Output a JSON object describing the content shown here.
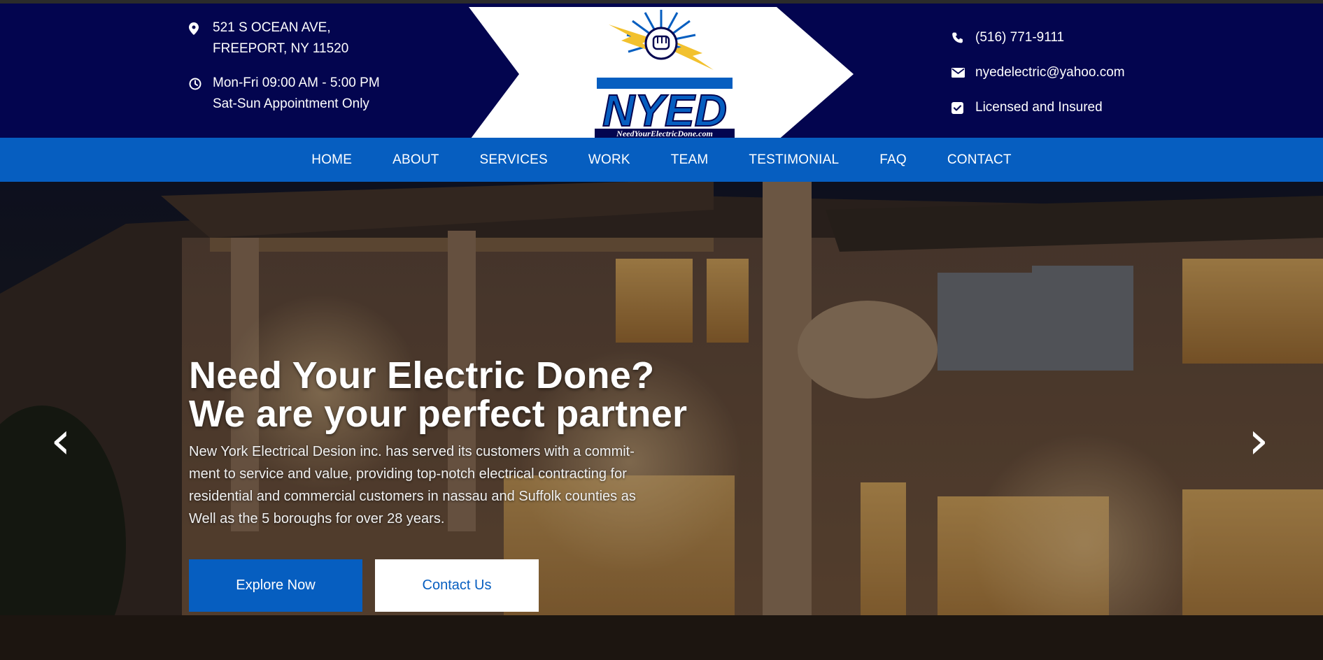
{
  "header": {
    "address_line1": "521 S OCEAN AVE,",
    "address_line2": "FREEPORT, NY 11520",
    "hours_line1": "Mon-Fri 09:00 AM - 5:00 PM",
    "hours_line2": "Sat-Sun Appointment Only",
    "phone": "(516) 771-9111",
    "email": "nyedelectric@yahoo.com",
    "license": "Licensed and Insured",
    "logo_text": "NYED",
    "logo_tagline": "NeedYourElectricDone.com"
  },
  "nav": {
    "items": [
      "HOME",
      "ABOUT",
      "SERVICES",
      "WORK",
      "TEAM",
      "TESTIMONIAL",
      "FAQ",
      "CONTACT"
    ]
  },
  "hero": {
    "title_line1": "Need Your Electric Done?",
    "title_line2": "We are your perfect partner",
    "description": "New York Electrical Desion inc. has served its customers with a commit-ment to service and value, providing top-notch electrical contracting for residential and commercial customers in nassau and Suffolk counties as Well as the 5 boroughs for over 28 years.",
    "primary_button": "Explore Now",
    "secondary_button": "Contact Us",
    "prev_arrow": "‹",
    "next_arrow": "›"
  },
  "colors": {
    "header_bg": "#03054f",
    "nav_bg": "#065ec0",
    "accent": "#065ec0",
    "bolt": "#f2c12e"
  },
  "icons": [
    "map-pin-icon",
    "clock-icon",
    "phone-icon",
    "envelope-icon",
    "checkbox-icon",
    "chevron-left-icon",
    "chevron-right-icon"
  ]
}
